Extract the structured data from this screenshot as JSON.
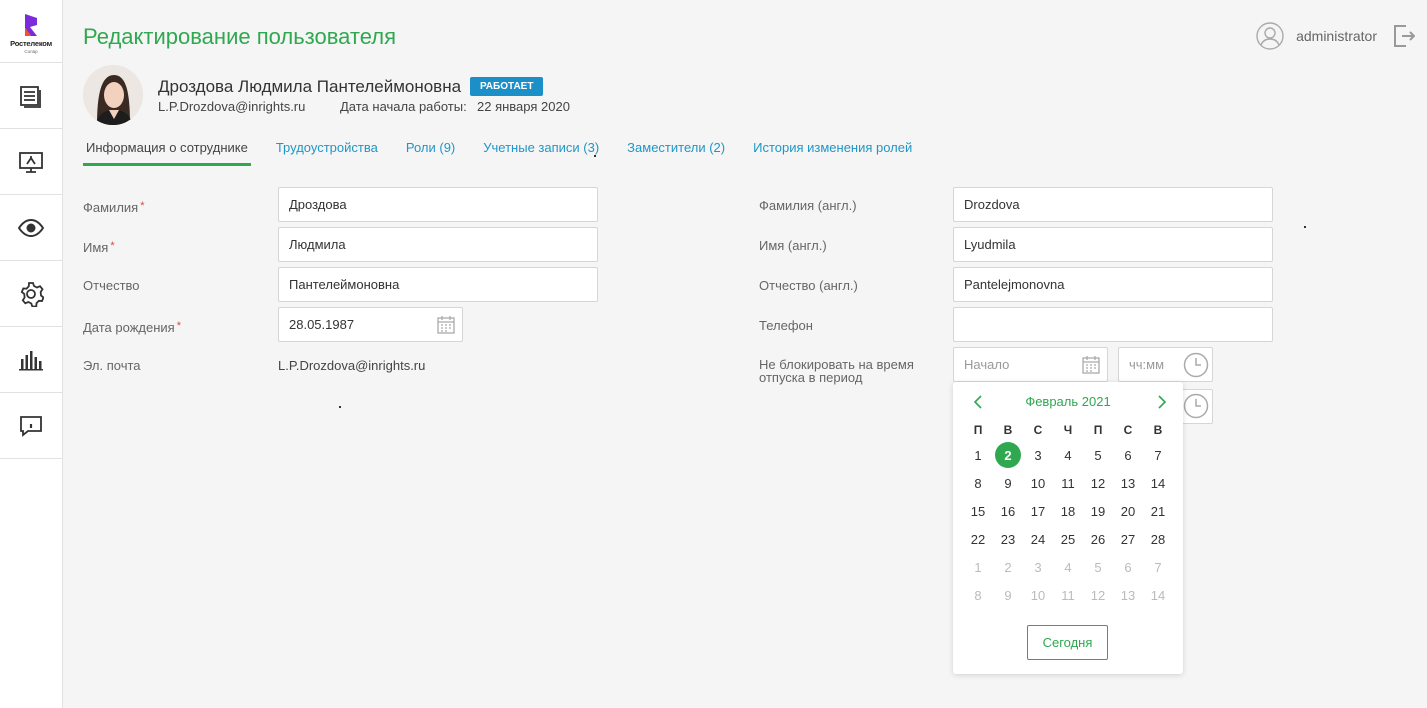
{
  "brand": {
    "name": "Ростелеком",
    "sub": "Солар"
  },
  "nav": [
    "documents-icon",
    "monitor-icon",
    "eye-icon",
    "gear-icon",
    "bar-chart-icon",
    "info-message-icon"
  ],
  "header": {
    "title": "Редактирование пользователя",
    "username": "administrator"
  },
  "profile": {
    "full_name": "Дроздова Людмила Пантелеймоновна",
    "status": "РАБОТАЕТ",
    "email": "L.P.Drozdova@inrights.ru",
    "start_label": "Дата начала работы:",
    "start_value": "22 января 2020"
  },
  "tabs": [
    {
      "label": "Информация о сотруднике",
      "active": true
    },
    {
      "label": "Трудоустройства"
    },
    {
      "label": "Роли (9)"
    },
    {
      "label": "Учетные записи (3)"
    },
    {
      "label": "Заместители (2)"
    },
    {
      "label": "История изменения ролей"
    }
  ],
  "form_left": {
    "last_name": {
      "label": "Фамилия",
      "value": "Дроздова",
      "required": true
    },
    "first_name": {
      "label": "Имя",
      "value": "Людмила",
      "required": true
    },
    "patronymic": {
      "label": "Отчество",
      "value": "Пантелеймоновна"
    },
    "birth_date": {
      "label": "Дата рождения",
      "value": "28.05.1987",
      "required": true
    },
    "email": {
      "label": "Эл. почта",
      "value": "L.P.Drozdova@inrights.ru"
    }
  },
  "form_right": {
    "last_name_en": {
      "label": "Фамилия (англ.)",
      "value": "Drozdova"
    },
    "first_name_en": {
      "label": "Имя (англ.)",
      "value": "Lyudmila"
    },
    "patronymic_en": {
      "label": "Отчество (англ.)",
      "value": "Pantelejmonovna"
    },
    "phone": {
      "label": "Телефон",
      "value": ""
    },
    "vacation": {
      "label_line1": "Не блокировать на время",
      "label_line2": "отпуска в период",
      "start_placeholder": "Начало",
      "time_placeholder": "чч:мм"
    }
  },
  "calendar": {
    "month": "Февраль 2021",
    "weekdays": [
      "П",
      "В",
      "С",
      "Ч",
      "П",
      "С",
      "В"
    ],
    "weeks": [
      [
        "1",
        "2",
        "3",
        "4",
        "5",
        "6",
        "7"
      ],
      [
        "8",
        "9",
        "10",
        "11",
        "12",
        "13",
        "14"
      ],
      [
        "15",
        "16",
        "17",
        "18",
        "19",
        "20",
        "21"
      ],
      [
        "22",
        "23",
        "24",
        "25",
        "26",
        "27",
        "28"
      ],
      [
        "1",
        "2",
        "3",
        "4",
        "5",
        "6",
        "7"
      ],
      [
        "8",
        "9",
        "10",
        "11",
        "12",
        "13",
        "14"
      ]
    ],
    "other_month_weeks_from": 4,
    "selected": "2",
    "today_label": "Сегодня"
  },
  "colors": {
    "accent": "#2fa84f",
    "link": "#1e97c7",
    "badge": "#1b8fc7",
    "required": "#e84040"
  }
}
